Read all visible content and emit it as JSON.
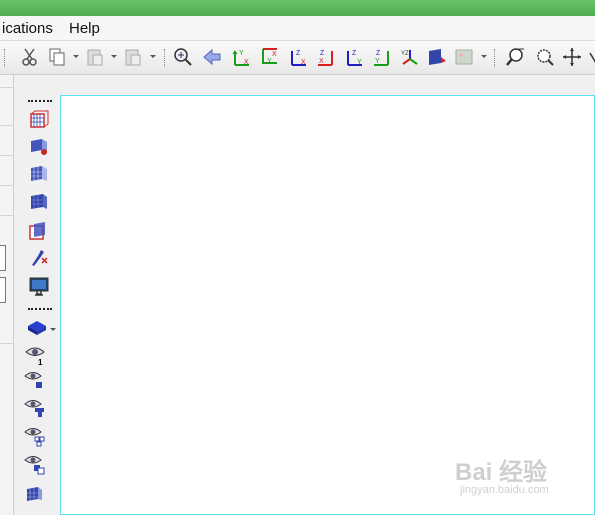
{
  "menu": {
    "item1": "ications",
    "item2": "Help"
  },
  "toolbar": {
    "icons": [
      "cut-icon",
      "copy-icon",
      "paste-icon",
      "paste-special-icon",
      "zoom-fit-icon",
      "back-arrow-icon",
      "view-xy-icon",
      "view-yx-icon",
      "view-zx-icon",
      "view-xz-icon",
      "view-zy-icon",
      "view-yz-icon",
      "isometric-icon",
      "render-icon",
      "image-icon",
      "zoom-in-icon",
      "zoom-box-icon",
      "pan-icon",
      "rotate-icon"
    ]
  },
  "sidebar": {
    "icons": [
      "mesh-box-icon",
      "mesh-color-icon",
      "mesh-grid-icon",
      "mesh-solid-icon",
      "mesh-wire-icon",
      "probe-icon",
      "monitor-icon",
      "layer-icon",
      "eye-1-icon",
      "eye-part-icon",
      "eye-tree-icon",
      "eye-tree2-icon",
      "eye-group-icon",
      "mesh-small-icon"
    ],
    "eye_label": "1"
  },
  "watermark": {
    "logo": "Bai 经验",
    "sub": "jingyan.baidu.com"
  },
  "colors": {
    "titlebar": "#5cb85c",
    "canvas_border": "#5ee0f0",
    "axis_green": "#1a9e1a",
    "axis_red": "#d42020",
    "axis_blue": "#2020c0"
  }
}
